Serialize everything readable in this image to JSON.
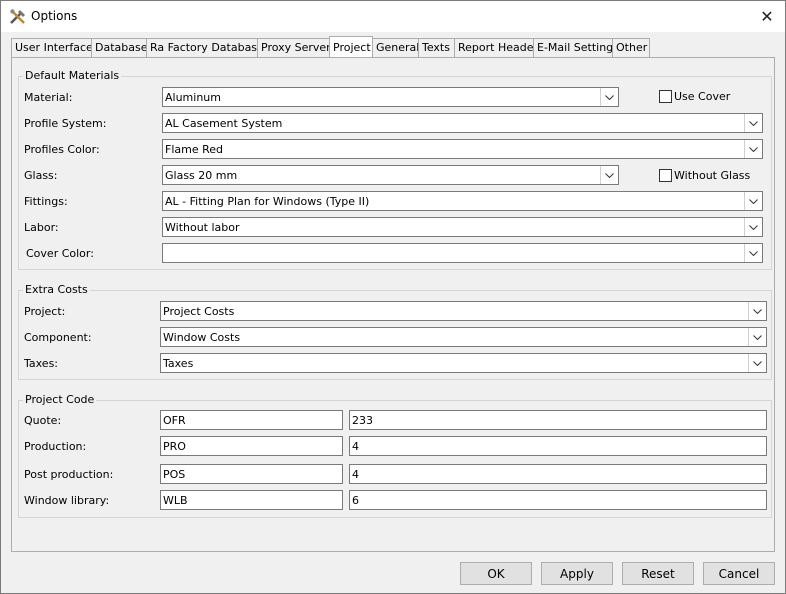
{
  "window": {
    "title": "Options",
    "close_glyph": "✕"
  },
  "tabs": [
    {
      "label": "User Interface"
    },
    {
      "label": "Database"
    },
    {
      "label": "Ra Factory Database"
    },
    {
      "label": "Proxy Server"
    },
    {
      "label": "Project",
      "active": true
    },
    {
      "label": "General"
    },
    {
      "label": "Texts"
    },
    {
      "label": "Report Header"
    },
    {
      "label": "E-Mail Settings"
    },
    {
      "label": "Other"
    }
  ],
  "default_materials": {
    "title": "Default Materials",
    "material": {
      "label": "Material:",
      "value": "Aluminum"
    },
    "use_cover": {
      "label": "Use Cover",
      "checked": false
    },
    "profile_system": {
      "label": "Profile System:",
      "value": "AL Casement System"
    },
    "profiles_color": {
      "label": "Profiles Color:",
      "value": "Flame Red"
    },
    "glass": {
      "label": "Glass:",
      "value": "Glass 20 mm"
    },
    "without_glass": {
      "label": "Without Glass",
      "checked": false
    },
    "fittings": {
      "label": "Fittings:",
      "value": "AL - Fitting Plan for Windows (Type II)"
    },
    "labor": {
      "label": "Labor:",
      "value": "Without labor"
    },
    "cover_color": {
      "label": "Cover Color:",
      "value": ""
    }
  },
  "extra_costs": {
    "title": "Extra Costs",
    "project": {
      "label": "Project:",
      "value": "Project Costs"
    },
    "component": {
      "label": "Component:",
      "value": "Window Costs"
    },
    "taxes": {
      "label": "Taxes:",
      "value": "Taxes"
    }
  },
  "project_code": {
    "title": "Project Code",
    "quote": {
      "label": "Quote:",
      "prefix": "OFR",
      "number": "233"
    },
    "production": {
      "label": "Production:",
      "prefix": "PRO",
      "number": "4"
    },
    "post_production": {
      "label": "Post production:",
      "prefix": "POS",
      "number": "4"
    },
    "window_library": {
      "label": "Window library:",
      "prefix": "WLB",
      "number": "6"
    }
  },
  "buttons": {
    "ok": "OK",
    "apply": "Apply",
    "reset": "Reset",
    "cancel": "Cancel"
  },
  "icons": {
    "app": "tools-icon",
    "dropdown": "chevron-down-icon"
  },
  "colors": {
    "window_bg": "#f0f0f0",
    "title_bg": "#ffffff",
    "border": "#7a7a7a"
  }
}
